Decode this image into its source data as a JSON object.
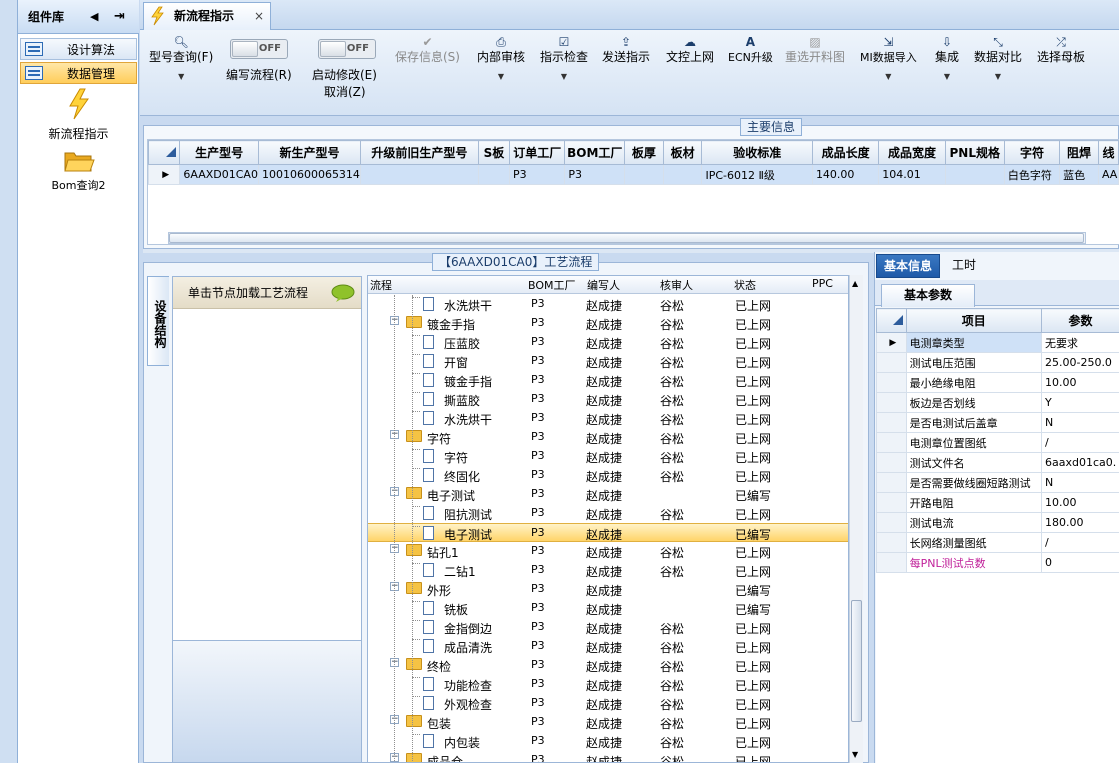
{
  "left_panel": {
    "title": "组件库",
    "items": [
      {
        "label": "设计算法",
        "active": false
      },
      {
        "label": "数据管理",
        "active": true
      }
    ],
    "big_items": [
      {
        "label": "新流程指示",
        "icon": "lightning-icon"
      },
      {
        "label": "Bom查询2",
        "icon": "folder-open-icon"
      }
    ]
  },
  "tab": {
    "label": "新流程指示",
    "close": "×"
  },
  "toolbar": {
    "model_query": "型号查询(F)",
    "write_flow_toggle": "OFF",
    "write_flow": "编写流程(R)",
    "start_modify_toggle": "OFF",
    "start_modify": "启动修改(E)",
    "cancel": "取消(Z)",
    "save_info": "保存信息(S)",
    "internal_review": "内部审核",
    "instruction_check": "指示检查",
    "send_instruction": "发送指示",
    "doc_upload": "文控上网",
    "ecn_upgrade": "ECN升级",
    "reissue_drawing": "重选开料图",
    "mi_import": "MI数据导入",
    "integrate": "集成",
    "data_compare": "数据对比",
    "select_mother": "选择母板"
  },
  "main_info": {
    "title": "主要信息",
    "columns": [
      "生产型号",
      "新生产型号",
      "升级前旧生产型号",
      "S板",
      "订单工厂",
      "BOM工厂",
      "板厚",
      "板材",
      "验收标准",
      "成品长度",
      "成品宽度",
      "PNL规格",
      "字符",
      "阻焊",
      "线"
    ],
    "row": [
      "6AAXD01CA0",
      "10010600065314",
      "",
      "",
      "P3",
      "P3",
      "",
      "",
      "IPC-6012 Ⅱ级",
      "140.00",
      "104.01",
      "",
      "白色字符",
      "蓝色",
      "AA"
    ]
  },
  "flow": {
    "title": "【6AAXD01CA0】工艺流程",
    "side_tab": "设备结构",
    "load_hint": "单击节点加载工艺流程",
    "columns": [
      "流程",
      "BOM工厂",
      "编写人",
      "核审人",
      "状态",
      "PPC"
    ],
    "rows": [
      {
        "level": 2,
        "name": "水洗烘干",
        "bom": "P3",
        "writer": "赵成捷",
        "reviewer": "谷松",
        "status": "已上网"
      },
      {
        "level": 1,
        "name": "镀金手指",
        "bom": "P3",
        "writer": "赵成捷",
        "reviewer": "谷松",
        "status": "已上网"
      },
      {
        "level": 2,
        "name": "压蓝胶",
        "bom": "P3",
        "writer": "赵成捷",
        "reviewer": "谷松",
        "status": "已上网"
      },
      {
        "level": 2,
        "name": "开窗",
        "bom": "P3",
        "writer": "赵成捷",
        "reviewer": "谷松",
        "status": "已上网"
      },
      {
        "level": 2,
        "name": "镀金手指",
        "bom": "P3",
        "writer": "赵成捷",
        "reviewer": "谷松",
        "status": "已上网"
      },
      {
        "level": 2,
        "name": "撕蓝胶",
        "bom": "P3",
        "writer": "赵成捷",
        "reviewer": "谷松",
        "status": "已上网"
      },
      {
        "level": 2,
        "name": "水洗烘干",
        "bom": "P3",
        "writer": "赵成捷",
        "reviewer": "谷松",
        "status": "已上网"
      },
      {
        "level": 1,
        "name": "字符",
        "bom": "P3",
        "writer": "赵成捷",
        "reviewer": "谷松",
        "status": "已上网"
      },
      {
        "level": 2,
        "name": "字符",
        "bom": "P3",
        "writer": "赵成捷",
        "reviewer": "谷松",
        "status": "已上网"
      },
      {
        "level": 2,
        "name": "终固化",
        "bom": "P3",
        "writer": "赵成捷",
        "reviewer": "谷松",
        "status": "已上网"
      },
      {
        "level": 1,
        "name": "电子测试",
        "bom": "P3",
        "writer": "赵成捷",
        "reviewer": "",
        "status": "已编写"
      },
      {
        "level": 2,
        "name": "阻抗测试",
        "bom": "P3",
        "writer": "赵成捷",
        "reviewer": "谷松",
        "status": "已上网"
      },
      {
        "level": 2,
        "name": "电子测试",
        "bom": "P3",
        "writer": "赵成捷",
        "reviewer": "",
        "status": "已编写",
        "selected": true
      },
      {
        "level": 1,
        "name": "钻孔1",
        "bom": "P3",
        "writer": "赵成捷",
        "reviewer": "谷松",
        "status": "已上网"
      },
      {
        "level": 2,
        "name": "二钻1",
        "bom": "P3",
        "writer": "赵成捷",
        "reviewer": "谷松",
        "status": "已上网"
      },
      {
        "level": 1,
        "name": "外形",
        "bom": "P3",
        "writer": "赵成捷",
        "reviewer": "",
        "status": "已编写"
      },
      {
        "level": 2,
        "name": "铣板",
        "bom": "P3",
        "writer": "赵成捷",
        "reviewer": "",
        "status": "已编写"
      },
      {
        "level": 2,
        "name": "金指倒边",
        "bom": "P3",
        "writer": "赵成捷",
        "reviewer": "谷松",
        "status": "已上网"
      },
      {
        "level": 2,
        "name": "成品清洗",
        "bom": "P3",
        "writer": "赵成捷",
        "reviewer": "谷松",
        "status": "已上网"
      },
      {
        "level": 1,
        "name": "终检",
        "bom": "P3",
        "writer": "赵成捷",
        "reviewer": "谷松",
        "status": "已上网"
      },
      {
        "level": 2,
        "name": "功能检查",
        "bom": "P3",
        "writer": "赵成捷",
        "reviewer": "谷松",
        "status": "已上网"
      },
      {
        "level": 2,
        "name": "外观检查",
        "bom": "P3",
        "writer": "赵成捷",
        "reviewer": "谷松",
        "status": "已上网"
      },
      {
        "level": 1,
        "name": "包装",
        "bom": "P3",
        "writer": "赵成捷",
        "reviewer": "谷松",
        "status": "已上网"
      },
      {
        "level": 2,
        "name": "内包装",
        "bom": "P3",
        "writer": "赵成捷",
        "reviewer": "谷松",
        "status": "已上网"
      },
      {
        "level": 1,
        "name": "成品仓",
        "bom": "P3",
        "writer": "赵成捷",
        "reviewer": "谷松",
        "status": "已上网"
      }
    ]
  },
  "right_panel": {
    "tabs": [
      "基本信息",
      "工时"
    ],
    "subtab": "基本参数",
    "columns": [
      "项目",
      "参数"
    ],
    "rows": [
      {
        "item": "电测章类型",
        "value": "无要求",
        "selected": true
      },
      {
        "item": "测试电压范围",
        "value": "25.00-250.0"
      },
      {
        "item": "最小绝缘电阻",
        "value": "10.00"
      },
      {
        "item": "板边是否划线",
        "value": "Y"
      },
      {
        "item": "是否电测试后盖章",
        "value": "N"
      },
      {
        "item": "电测章位置图纸",
        "value": "/"
      },
      {
        "item": "测试文件名",
        "value": "6aaxd01ca0."
      },
      {
        "item": "是否需要做线圈短路测试",
        "value": "N"
      },
      {
        "item": "开路电阻",
        "value": "10.00"
      },
      {
        "item": "测试电流",
        "value": "180.00"
      },
      {
        "item": "长网络测量图纸",
        "value": "/"
      },
      {
        "item": "每PNL测试点数",
        "value": "0",
        "highlight": true
      }
    ]
  }
}
